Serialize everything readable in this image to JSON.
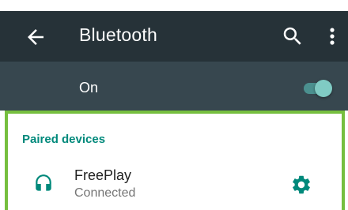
{
  "app_bar": {
    "title": "Bluetooth",
    "background": "#263238",
    "icons": [
      "arrow-back-icon",
      "search-icon",
      "more-vert-icon"
    ]
  },
  "master_switch": {
    "label": "On",
    "checked": true,
    "background": "#37474f",
    "accent": "#80cbc4"
  },
  "paired_devices": {
    "header": "Paired devices",
    "header_color": "#00897b",
    "highlight_color": "#76bf3f",
    "devices": [
      {
        "name": "FreePlay",
        "status": "Connected",
        "icon": "headphones-icon",
        "settings_icon": "gear-icon"
      }
    ]
  }
}
